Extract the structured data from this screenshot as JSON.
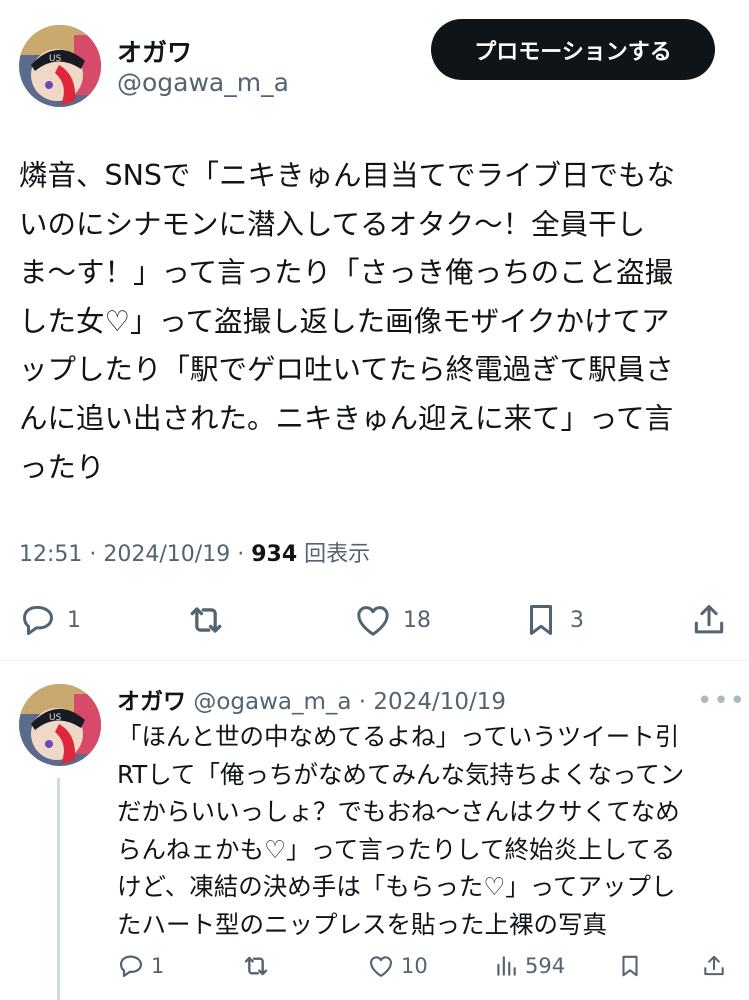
{
  "tweet": {
    "author_name": "オガワ",
    "author_handle": "@ogawa_m_a",
    "promote_label": "プロモーションする",
    "text": "燐音、SNSで「ニキきゅん目当てでライブ日でもな\nいのにシナモンに潜入してるオタク〜！全員干し\nま〜す！」って言ったり「さっき俺っちのこと盗撮\nした女♡」って盗撮し返した画像モザイクかけてア\nップしたり「駅でゲロ吐いてたら終電過ぎて駅員さ\nんに追い出された。ニキきゅん迎えに来て」って言\nったり",
    "time": "12:51",
    "date": "2024/10/19",
    "views": "934",
    "views_label": "回表示",
    "replies": "1",
    "likes": "18",
    "bookmarks": "3"
  },
  "reply": {
    "author_name": "オガワ",
    "author_handle": "@ogawa_m_a",
    "date": "2024/10/19",
    "text": "「ほんと世の中なめてるよね」っていうツイート引\nRTして「俺っちがなめてみんな気持ちよくなってン\nだからいいっしょ？でもおね〜さんはクサくてなめ\nらんねェかも♡」って言ったりして終始炎上してる\nけど、凍結の決め手は「もらった♡」ってアップし\nたハート型のニップレスを貼った上裸の写真",
    "replies": "1",
    "likes": "10",
    "views": "594"
  },
  "icons": {
    "reply": "reply-icon",
    "retweet": "retweet-icon",
    "like": "heart-icon",
    "bookmark": "bookmark-icon",
    "share": "share-icon",
    "views": "analytics-icon",
    "more": "more-icon"
  },
  "colors": {
    "text": "#0f1419",
    "secondary": "#536471",
    "button_bg": "#0f1419",
    "divider": "#eff3f4",
    "thread_line": "#cfd9de"
  }
}
